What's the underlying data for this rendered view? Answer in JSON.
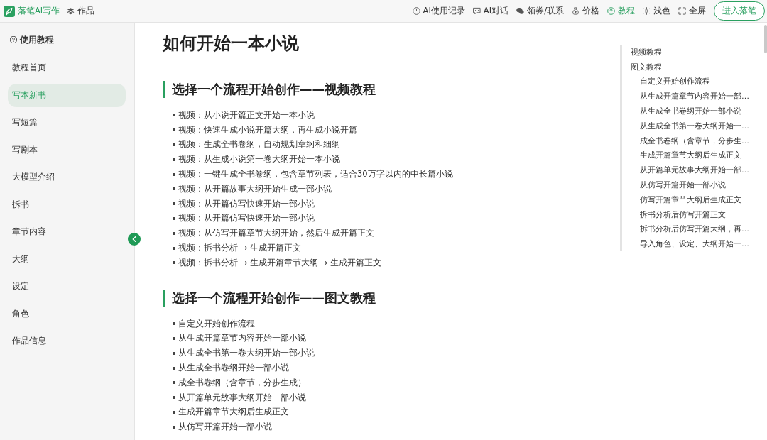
{
  "top_bar": {
    "brand": "落笔AI写作",
    "works_link": "作品",
    "nav": [
      {
        "label": "AI使用记录",
        "selected": false
      },
      {
        "label": "AI对话",
        "selected": false
      },
      {
        "label": "领券/联系",
        "selected": false
      },
      {
        "label": "价格",
        "selected": false
      },
      {
        "label": "教程",
        "selected": true
      },
      {
        "label": "浅色",
        "selected": false
      },
      {
        "label": "全屏",
        "selected": false
      }
    ],
    "enter_button": "进入落笔"
  },
  "sidebar": {
    "title": "使用教程",
    "items": [
      {
        "label": "教程首页",
        "selected": false
      },
      {
        "label": "写本新书",
        "selected": true
      },
      {
        "label": "写短篇",
        "selected": false
      },
      {
        "label": "写剧本",
        "selected": false
      },
      {
        "label": "大模型介绍",
        "selected": false
      },
      {
        "label": "拆书",
        "selected": false
      },
      {
        "label": "章节内容",
        "selected": false
      },
      {
        "label": "大纲",
        "selected": false
      },
      {
        "label": "设定",
        "selected": false
      },
      {
        "label": "角色",
        "selected": false
      },
      {
        "label": "作品信息",
        "selected": false
      }
    ]
  },
  "article": {
    "title": "如何开始一本小说",
    "sections": [
      {
        "heading": "选择一个流程开始创作——视频教程",
        "items": [
          "视频：从小说开篇正文开始一本小说",
          "视频：快速生成小说开篇大纲，再生成小说开篇",
          "视频：生成全书卷纲，自动规划章纲和细纲",
          "视频：从生成小说第一卷大纲开始一本小说",
          "视频：一键生成全书卷纲，包含章节列表，适合30万字以内的中长篇小说",
          "视频：从开篇故事大纲开始生成一部小说",
          "视频：从开篇仿写快速开始一部小说",
          "视频：从开篇仿写快速开始一部小说",
          "视频：从仿写开篇章节大纲开始，然后生成开篇正文",
          "视频：拆书分析 → 生成开篇正文",
          "视频：拆书分析 → 生成开篇章节大纲 → 生成开篇正文"
        ]
      },
      {
        "heading": "选择一个流程开始创作——图文教程",
        "items": [
          "自定义开始创作流程",
          "从生成开篇章节内容开始一部小说",
          "从生成全书第一卷大纲开始一部小说",
          "从生成全书卷纲开始一部小说",
          "成全书卷纲（含章节，分步生成）",
          "从开篇单元故事大纲开始一部小说",
          "生成开篇章节大纲后生成正文",
          "从仿写开篇开始一部小说"
        ]
      }
    ]
  },
  "toc": {
    "items": [
      {
        "label": "视频教程"
      },
      {
        "label": "图文教程",
        "children": [
          {
            "label": "自定义开始创作流程"
          },
          {
            "label": "从生成开篇章节内容开始一部…"
          },
          {
            "label": "从生成全书卷纲开始一部小说"
          },
          {
            "label": "从生成全书第一卷大纲开始一…"
          },
          {
            "label": "成全书卷纲（含章节，分步生…"
          },
          {
            "label": "生成开篇章节大纲后生成正文"
          },
          {
            "label": "从开篇单元故事大纲开始一部…"
          },
          {
            "label": "从仿写开篇开始一部小说"
          },
          {
            "label": "仿写开篇章节大纲后生成正文"
          },
          {
            "label": "拆书分析后仿写开篇正文"
          },
          {
            "label": "拆书分析后仿写开篇大纲，再…"
          },
          {
            "label": "导入角色、设定、大纲开始一…"
          }
        ]
      }
    ]
  }
}
